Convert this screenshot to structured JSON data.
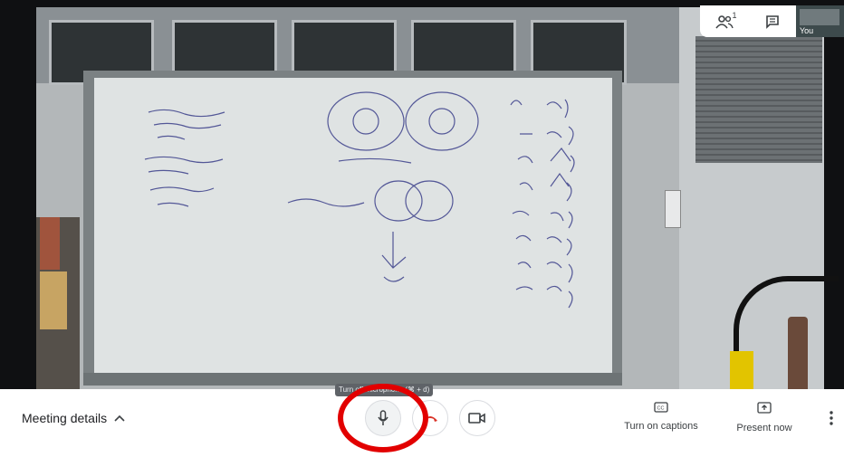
{
  "top_panel": {
    "participants_icon": "people-icon",
    "participants_count": "1",
    "chat_icon": "chat-icon",
    "self_label": "You"
  },
  "bottom_bar": {
    "meeting_details_label": "Meeting details",
    "meeting_details_icon": "chevron-up-icon",
    "mic_tooltip": "Turn off microphone (⌘ + d)",
    "mic_icon": "microphone-icon",
    "hangup_icon": "hang-up-icon",
    "camera_icon": "videocam-icon",
    "captions_label": "Turn on captions",
    "captions_icon": "closed-captions-icon",
    "present_label": "Present now",
    "present_icon": "present-screen-icon",
    "more_icon": "more-vert-icon"
  },
  "colors": {
    "hangup_red": "#d93025",
    "highlight_ring": "#e20000",
    "icon_gray": "#3c4043"
  }
}
